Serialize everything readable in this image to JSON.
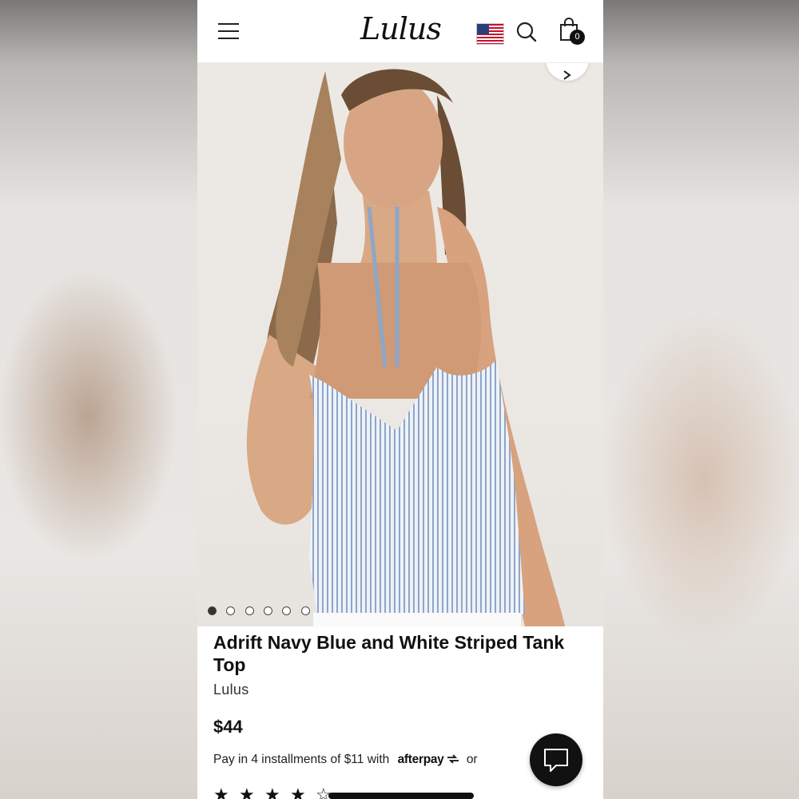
{
  "header": {
    "brand_logo_text": "Lulus",
    "cart_count": "0",
    "icons": [
      "hamburger-menu-icon",
      "us-flag-icon",
      "search-icon",
      "shopping-bag-icon"
    ]
  },
  "gallery": {
    "image_count": 6,
    "active_index": 0,
    "icons": [
      "chevron-right-icon"
    ]
  },
  "product": {
    "title": "Adrift Navy Blue and White Striped Tank Top",
    "brand": "Lulus",
    "price": "$44",
    "installments_text": "Pay in 4 installments of $11 with",
    "afterpay_label": "afterpay",
    "installments_suffix": "or"
  },
  "rating": {
    "stars_full": 4,
    "stars_total": 5
  },
  "chat": {
    "icon": "chat-bubble-icon"
  },
  "colors": {
    "accent": "#111111",
    "background": "#ffffff"
  }
}
